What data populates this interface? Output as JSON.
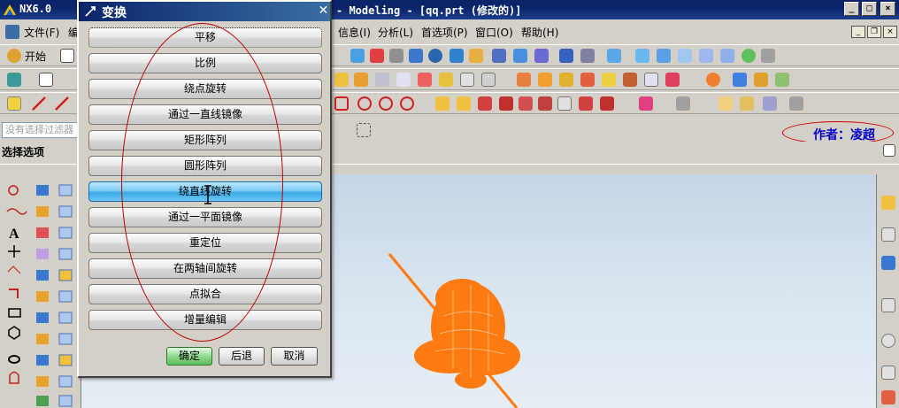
{
  "window": {
    "app_name": "NX6.0",
    "title_right": "- Modeling - [qq.prt (修改的)]",
    "controls": [
      "_",
      "□",
      "×"
    ]
  },
  "menubar": {
    "items_left": [
      "文件(F)",
      "编"
    ],
    "items_right": [
      "信息(I)",
      "分析(L)",
      "首选项(P)",
      "窗口(O)",
      "帮助(H)"
    ]
  },
  "toolbar": {
    "start_label": "开始"
  },
  "filter": {
    "placeholder": "没有选择过滤器"
  },
  "author": "作者：凌超",
  "selection_panel": {
    "title": "选择选项"
  },
  "dialog": {
    "title": "变换",
    "options": [
      "平移",
      "比例",
      "绕点旋转",
      "通过一直线镜像",
      "矩形阵列",
      "圆形阵列",
      "绕直线旋转",
      "通过一平面镜像",
      "重定位",
      "在两轴间旋转",
      "点拟合",
      "增量编辑"
    ],
    "active_index": 6,
    "buttons": {
      "ok": "确定",
      "back": "后退",
      "cancel": "取消"
    }
  },
  "colors": {
    "titlebar": "#0a246a",
    "highlight": "#3aa9e6",
    "model": "#ff7a10",
    "annotation": "#c00000",
    "author_text": "#0000c8"
  }
}
